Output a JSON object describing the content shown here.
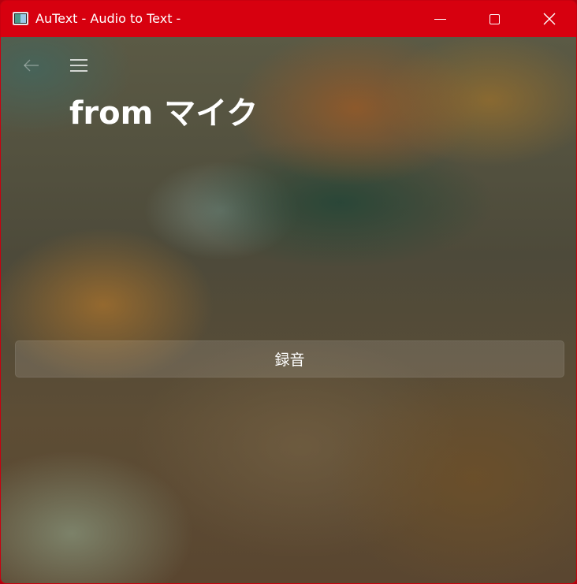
{
  "window": {
    "title": "AuText - Audio to Text -"
  },
  "nav": {
    "back_icon": "arrow-left-icon",
    "menu_icon": "hamburger-menu-icon"
  },
  "page": {
    "title": "from マイク"
  },
  "main": {
    "record_label": "録音"
  },
  "colors": {
    "titlebar": "#d7000f",
    "text": "#ffffff"
  }
}
